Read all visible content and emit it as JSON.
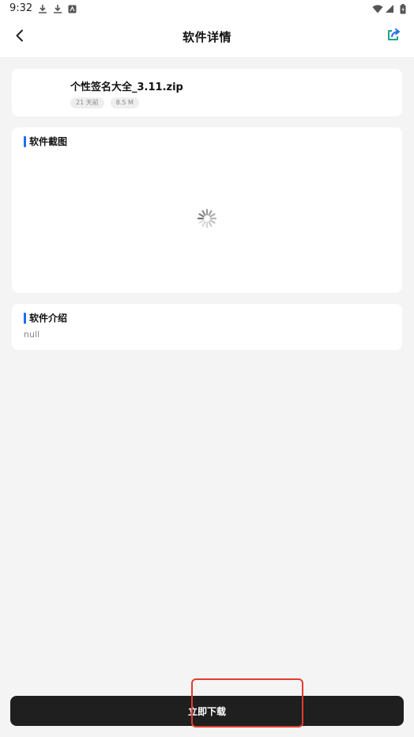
{
  "status_bar": {
    "time": "9:32",
    "icons": [
      "download-icon",
      "download-icon",
      "app-notification-icon",
      "wifi-icon",
      "signal-icon",
      "battery-icon"
    ]
  },
  "header": {
    "title": "软件详情",
    "back_icon": "chevron-left-icon",
    "share_icon": "share-icon",
    "accent_color": "#1e6ef5"
  },
  "file": {
    "name": "个性签名大全_3.11.zip",
    "tags": [
      "21 天前",
      "8.5 M"
    ]
  },
  "screenshots": {
    "title": "软件截图",
    "loading_icon": "loading-spinner-icon"
  },
  "intro": {
    "title": "软件介绍",
    "text": "null"
  },
  "download": {
    "label": "立即下载",
    "bg_color": "#1f1f1f",
    "highlight_color": "#e23b2e"
  }
}
